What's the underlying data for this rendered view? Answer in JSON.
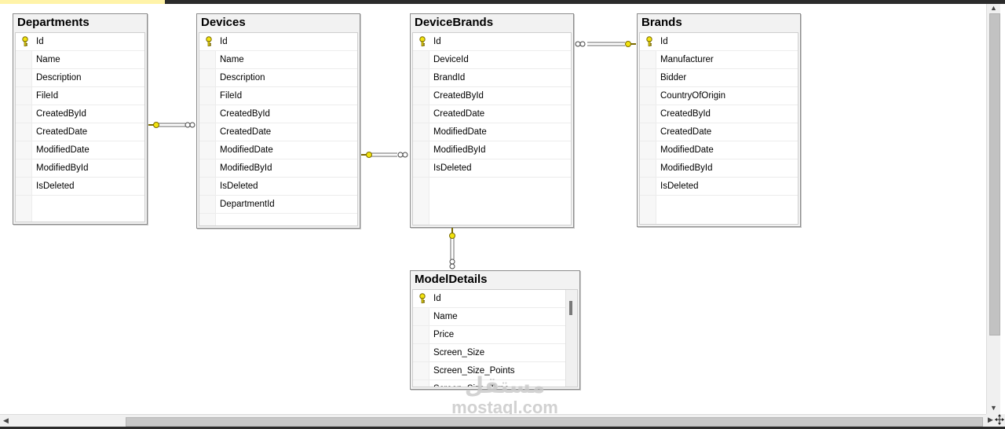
{
  "tables": [
    {
      "title": "Departments",
      "columns": [
        "Id",
        "Name",
        "Description",
        "FileId",
        "CreatedById",
        "CreatedDate",
        "ModifiedDate",
        "ModifiedById",
        "IsDeleted"
      ],
      "pk": "Id"
    },
    {
      "title": "Devices",
      "columns": [
        "Id",
        "Name",
        "Description",
        "FileId",
        "CreatedById",
        "CreatedDate",
        "ModifiedDate",
        "ModifiedById",
        "IsDeleted",
        "DepartmentId"
      ],
      "pk": "Id"
    },
    {
      "title": "DeviceBrands",
      "columns": [
        "Id",
        "DeviceId",
        "BrandId",
        "CreatedById",
        "CreatedDate",
        "ModifiedDate",
        "ModifiedById",
        "IsDeleted"
      ],
      "pk": "Id"
    },
    {
      "title": "Brands",
      "columns": [
        "Id",
        "Manufacturer",
        "Bidder",
        "CountryOfOrigin",
        "CreatedById",
        "CreatedDate",
        "ModifiedDate",
        "ModifiedById",
        "IsDeleted"
      ],
      "pk": "Id"
    },
    {
      "title": "ModelDetails",
      "columns": [
        "Id",
        "Name",
        "Price",
        "Screen_Size",
        "Screen_Size_Points",
        "Screen_Size_Type"
      ],
      "pk": "Id"
    }
  ],
  "watermark": {
    "arabic": "مستقل",
    "latin": "mostaql.com"
  },
  "colors": {
    "key_yellow": "#f2e30f",
    "key_outline": "#7a6a00",
    "relationship_line": "#6b6b6b"
  },
  "icons": {
    "primary_key": "key-icon",
    "one_end": "key-icon",
    "many_end": "infinity-icon"
  }
}
